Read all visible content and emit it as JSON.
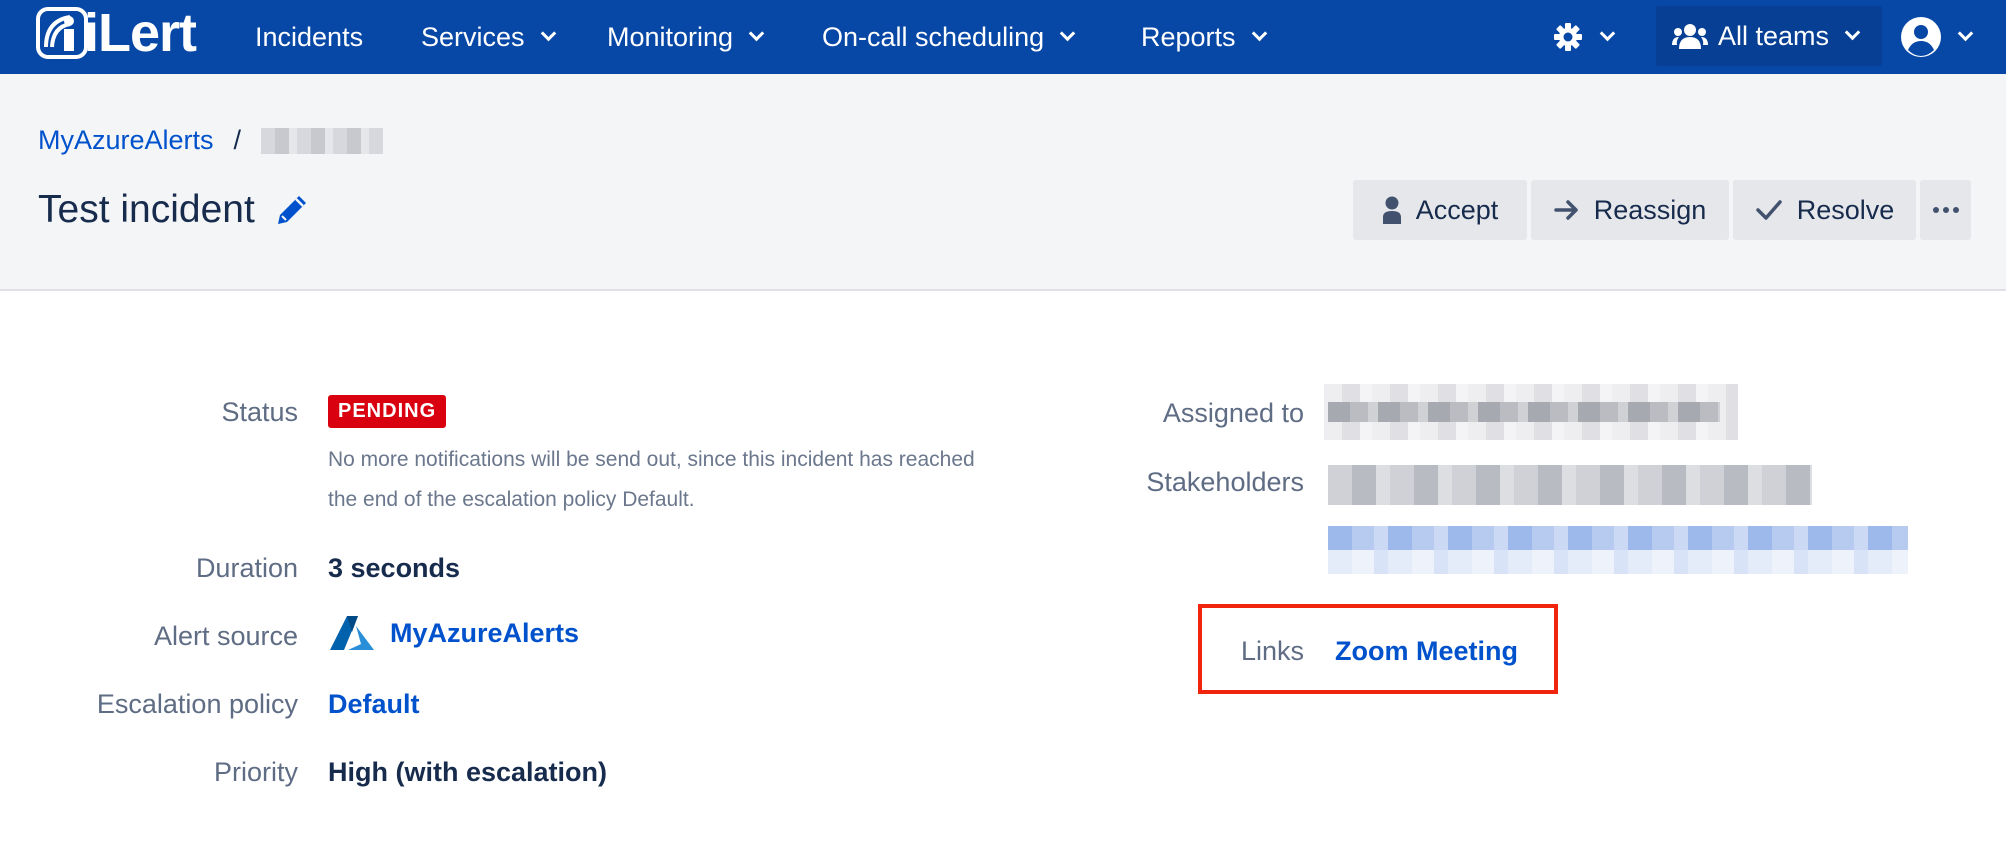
{
  "nav": {
    "logo_text": "iLert",
    "items": [
      {
        "label": "Incidents"
      },
      {
        "label": "Services"
      },
      {
        "label": "Monitoring"
      },
      {
        "label": "On-call scheduling"
      },
      {
        "label": "Reports"
      }
    ],
    "teams_label": "All teams"
  },
  "breadcrumb": {
    "root": "MyAzureAlerts",
    "separator": "/"
  },
  "title": "Test incident",
  "actions": {
    "accept": "Accept",
    "reassign": "Reassign",
    "resolve": "Resolve"
  },
  "details": {
    "status_label": "Status",
    "status_badge": "PENDING",
    "status_note": "No more notifications will be send out, since this incident has reached the end of the escalation policy Default.",
    "duration_label": "Duration",
    "duration_value": "3 seconds",
    "alert_source_label": "Alert source",
    "alert_source_value": "MyAzureAlerts",
    "escalation_label": "Escalation policy",
    "escalation_value": "Default",
    "priority_label": "Priority",
    "priority_value": "High (with escalation)",
    "assigned_label": "Assigned to",
    "stakeholders_label": "Stakeholders",
    "links_label": "Links",
    "links_value": "Zoom Meeting"
  },
  "colors": {
    "navbar": "#0747a6",
    "link": "#0052cc",
    "pending_badge": "#d9000f",
    "highlight_box": "#f1240e"
  }
}
